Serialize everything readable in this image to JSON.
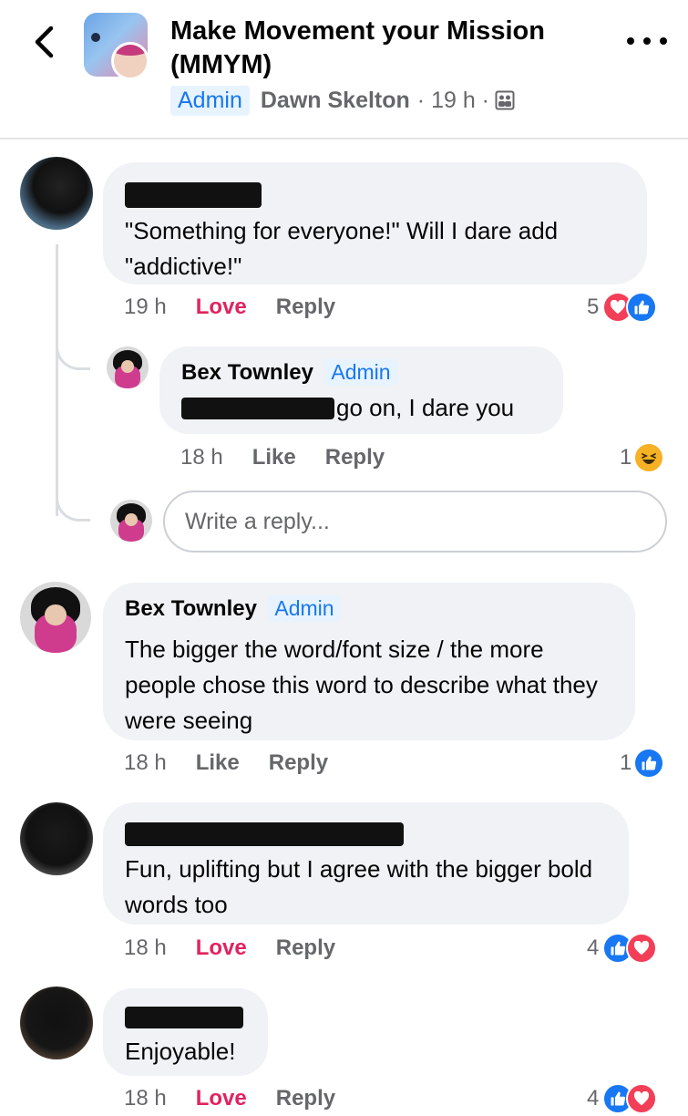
{
  "header": {
    "back_icon": "chevron-left-icon",
    "group_name": "Make Movement your Mission (MMYM)",
    "badge": "Admin",
    "author": "Dawn Skelton",
    "time": "· 19 h ·",
    "privacy_icon": "group-members-icon",
    "more_icon": "more-horizontal-icon"
  },
  "comments": [
    {
      "name_redacted": true,
      "text": "\"Something for everyone!\" Will I dare add \"addictive!\"",
      "time": "19 h",
      "reaction_action": "Love",
      "reply_label": "Reply",
      "reaction_count": "5",
      "reaction_icons": [
        "love-reaction-icon",
        "like-reaction-icon"
      ],
      "replies": [
        {
          "name": "Bex Townley",
          "badge": "Admin",
          "text": "go on, I dare  you",
          "time": "18 h",
          "reaction_action": "Like",
          "reply_label": "Reply",
          "reaction_count": "1",
          "reaction_icons": [
            "haha-reaction-icon"
          ]
        }
      ],
      "reply_placeholder": "Write a reply..."
    },
    {
      "name": "Bex Townley",
      "badge": "Admin",
      "text": "The bigger the word/font size / the more people chose this word to describe what they were seeing",
      "time": "18 h",
      "reaction_action": "Like",
      "reply_label": "Reply",
      "reaction_count": "1",
      "reaction_icons": [
        "like-reaction-icon"
      ]
    },
    {
      "name_redacted": true,
      "text": "Fun, uplifting but I agree with the bigger bold words too",
      "time": "18 h",
      "reaction_action": "Love",
      "reply_label": "Reply",
      "reaction_count": "4",
      "reaction_icons": [
        "like-reaction-icon",
        "love-reaction-icon"
      ]
    },
    {
      "name_redacted": true,
      "text": "Enjoyable!",
      "time": "18 h",
      "reaction_action": "Love",
      "reply_label": "Reply",
      "reaction_count": "4",
      "reaction_icons": [
        "like-reaction-icon",
        "love-reaction-icon"
      ]
    }
  ],
  "colors": {
    "bubble": "#f0f2f5",
    "love": "#e0245e",
    "accent": "#1877f2",
    "secondary_text": "#65676b"
  }
}
